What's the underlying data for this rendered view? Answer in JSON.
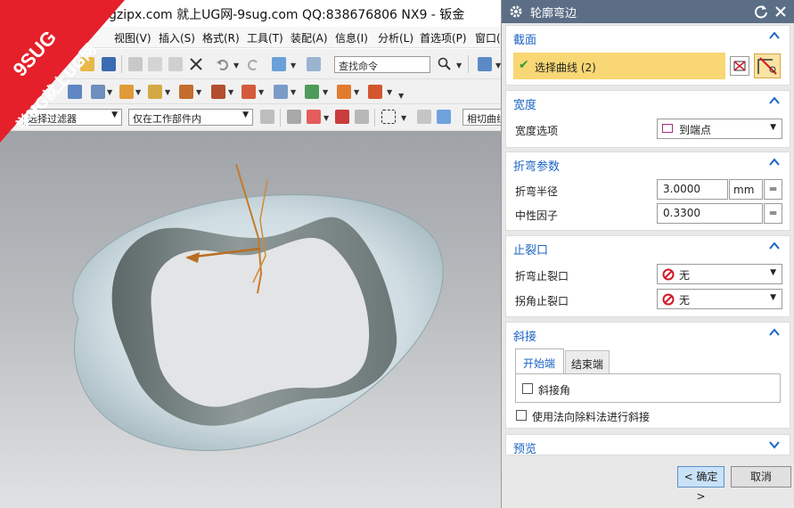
{
  "window": {
    "title": "gzipx.com 就上UG网-9sug.com QQ:838676806 NX9 - 钣金"
  },
  "logo": {
    "line1": "9SUG",
    "line2": "学UG就上UG网"
  },
  "menu": [
    "视图(V)",
    "插入(S)",
    "格式(R)",
    "工具(T)",
    "装配(A)",
    "信息(I)",
    "分析(L)",
    "首选项(P)",
    "窗口("
  ],
  "toolbar": {
    "search_placeholder": "查找命令",
    "selection_filter": "选择过滤器",
    "assembly_scope": "仅在工作部件内",
    "curve_rule": "相切曲线"
  },
  "dialog": {
    "title": "轮廓弯边",
    "sections": {
      "section": {
        "label": "截面",
        "select_curve": "选择曲线 (2)"
      },
      "width": {
        "label": "宽度",
        "option_label": "宽度选项",
        "option_value": "到端点"
      },
      "bend_params": {
        "label": "折弯参数",
        "radius_label": "折弯半径",
        "radius_value": "3.0000",
        "radius_unit": "mm",
        "kfactor_label": "中性因子",
        "kfactor_value": "0.3300"
      },
      "relief": {
        "label": "止裂口",
        "bend_relief_label": "折弯止裂口",
        "bend_relief_value": "无",
        "corner_relief_label": "拐角止裂口",
        "corner_relief_value": "无"
      },
      "miter": {
        "label": "斜接",
        "tab_start": "开始端",
        "tab_end": "结束端",
        "miter_angle": "斜接角",
        "normal_cutout": "使用法向除料法进行斜接"
      },
      "preview": {
        "label": "预览"
      }
    },
    "buttons": {
      "ok": "< 确定 >",
      "cancel": "取消"
    }
  },
  "colors": {
    "dialog_title": "#5b6e86",
    "section_header": "#1c64c4",
    "select_highlight": "#f8d774",
    "ok_button": "#c9e2f8",
    "no_icon": "#d11a2a",
    "logo_red": "#e5202a"
  }
}
